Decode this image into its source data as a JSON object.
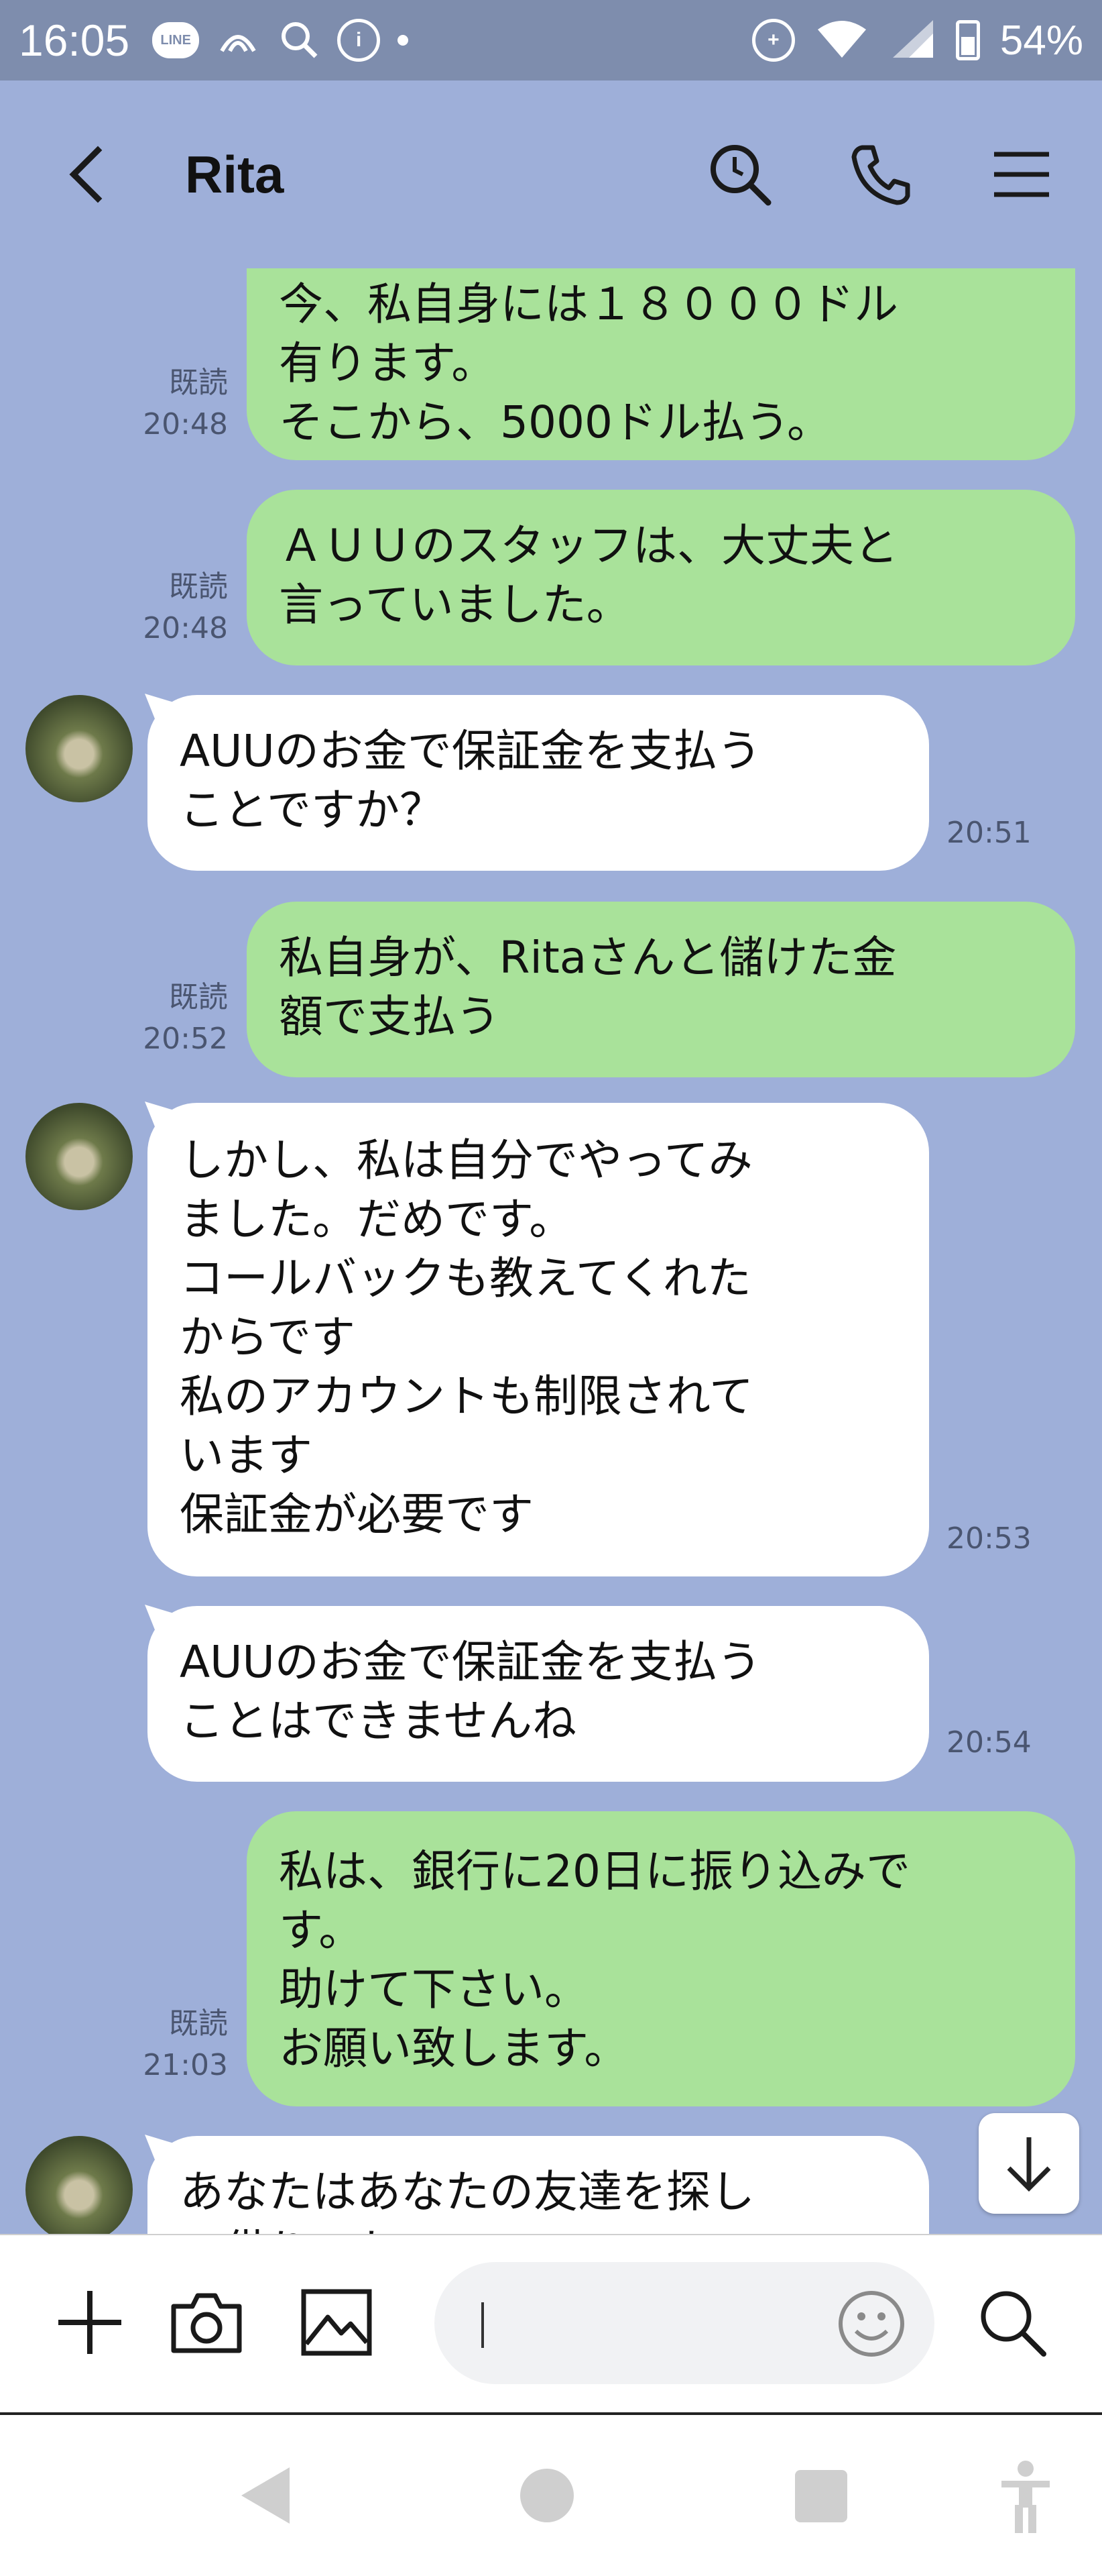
{
  "status_bar": {
    "time": "16:05",
    "line_badge": "LINE",
    "battery": "54%",
    "icons": [
      "line-icon",
      "wifi-call-icon",
      "search-shield-icon",
      "info-icon",
      "dot-icon",
      "data-saver-icon",
      "wifi-icon",
      "signal-icon",
      "battery-icon"
    ]
  },
  "header": {
    "title": "Rita",
    "icons": [
      "back-icon",
      "search-icon",
      "phone-icon",
      "menu-icon"
    ]
  },
  "messages": [
    {
      "type": "sent",
      "text": "今、私自身には１８０００ドル\n有ります。\nそこから、5000ドル払う。",
      "read": "既読",
      "time": "20:48"
    },
    {
      "type": "sent",
      "text": "ＡＵＵのスタッフは、大丈夫と\n言っていました。",
      "read": "既読",
      "time": "20:48"
    },
    {
      "type": "received",
      "text": "AUUのお金で保証金を支払う\nことですか？",
      "time": "20:51"
    },
    {
      "type": "sent",
      "text": "私自身が、Ritaさんと儲けた金\n額で支払う",
      "read": "既読",
      "time": "20:52"
    },
    {
      "type": "received",
      "text": "しかし、私は自分でやってみ\nました。だめです。\nコールバックも教えてくれた\nからです\n私のアカウントも制限されて\nいます\n保証金が必要です",
      "time": "20:53"
    },
    {
      "type": "received",
      "text": "AUUのお金で保証金を支払う\nことはできませんね",
      "time": "20:54"
    },
    {
      "type": "sent",
      "text": "私は、銀行に20日に振り込みで\nす。\n助けて下さい。\nお願い致します。",
      "read": "既読",
      "time": "21:03"
    },
    {
      "type": "received",
      "text": "あなたはあなたの友達を探し\nて借りてね"
    }
  ],
  "input_bar": {
    "placeholder": "",
    "icons": [
      "plus-icon",
      "camera-icon",
      "image-icon",
      "emoji-icon",
      "search-icon"
    ]
  },
  "colors": {
    "background": "#9eafd9",
    "sent_bubble": "#a9e29a",
    "received_bubble": "#ffffff",
    "status_bar": "#7e8dad"
  }
}
